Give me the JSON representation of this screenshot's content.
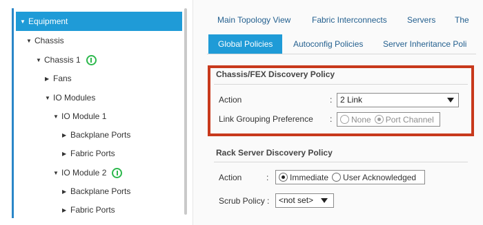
{
  "tree": {
    "equipment": "Equipment",
    "chassis": "Chassis",
    "chassis1": "Chassis 1",
    "fans": "Fans",
    "io_modules": "IO Modules",
    "io_module1": "IO Module 1",
    "backplane_ports_1": "Backplane Ports",
    "fabric_ports_1": "Fabric Ports",
    "io_module2": "IO Module 2",
    "backplane_ports_2": "Backplane Ports",
    "fabric_ports_2": "Fabric Ports"
  },
  "tabs": {
    "main_topology": "Main Topology View",
    "fabric_interconnects": "Fabric Interconnects",
    "servers": "Servers",
    "truncated": "The"
  },
  "subtabs": {
    "global_policies": "Global Policies",
    "autoconfig_policies": "Autoconfig Policies",
    "server_inheritance": "Server Inheritance Poli"
  },
  "chassis_policy": {
    "title": "Chassis/FEX Discovery Policy",
    "action_label": "Action",
    "action_value": "2 Link",
    "link_grouping_label": "Link Grouping Preference",
    "option_none": "None",
    "option_port_channel": "Port Channel"
  },
  "rack_policy": {
    "title": "Rack Server Discovery Policy",
    "action_label": "Action",
    "option_immediate": "Immediate",
    "option_user_ack": "User Acknowledged",
    "scrub_label": "Scrub Policy :",
    "scrub_value": "<not set>"
  },
  "colon": ":",
  "colors": {
    "accent": "#1f9bd7",
    "highlight_box": "#c8391c",
    "status_ok": "#2db84d",
    "link": "#24608f"
  }
}
